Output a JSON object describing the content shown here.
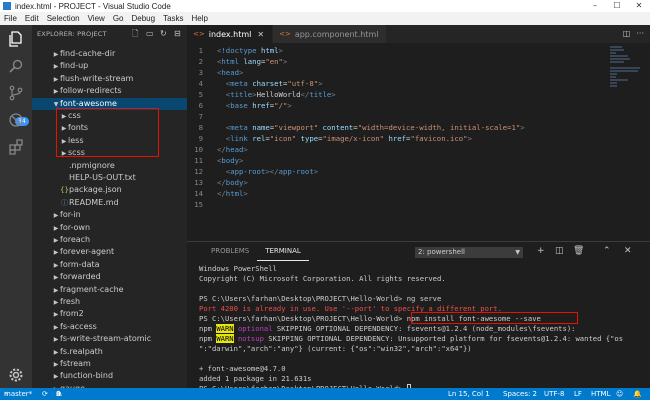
{
  "window": {
    "title": "index.html - PROJECT - Visual Studio Code",
    "controls": [
      "–",
      "☐",
      "✕"
    ]
  },
  "menu": [
    "File",
    "Edit",
    "Selection",
    "View",
    "Go",
    "Debug",
    "Tasks",
    "Help"
  ],
  "activity": {
    "scm_badge": "34"
  },
  "sidebar": {
    "header": "EXPLORER: PROJECT",
    "rows": [
      {
        "label": "find-cache-dir",
        "type": "folder"
      },
      {
        "label": "find-up",
        "type": "folder"
      },
      {
        "label": "flush-write-stream",
        "type": "folder"
      },
      {
        "label": "follow-redirects",
        "type": "folder"
      },
      {
        "label": "font-awesome",
        "type": "folder-open",
        "selected": true
      },
      {
        "label": "css",
        "type": "folder",
        "nested": true
      },
      {
        "label": "fonts",
        "type": "folder",
        "nested": true
      },
      {
        "label": "less",
        "type": "folder",
        "nested": true
      },
      {
        "label": "scss",
        "type": "folder",
        "nested": true
      },
      {
        "label": ".npmignore",
        "type": "file",
        "nested": true
      },
      {
        "label": "HELP-US-OUT.txt",
        "type": "file",
        "nested": true
      },
      {
        "label": "package.json",
        "type": "json",
        "nested": true
      },
      {
        "label": "README.md",
        "type": "md",
        "nested": true
      },
      {
        "label": "for-in",
        "type": "folder"
      },
      {
        "label": "for-own",
        "type": "folder"
      },
      {
        "label": "foreach",
        "type": "folder"
      },
      {
        "label": "forever-agent",
        "type": "folder"
      },
      {
        "label": "form-data",
        "type": "folder"
      },
      {
        "label": "forwarded",
        "type": "folder"
      },
      {
        "label": "fragment-cache",
        "type": "folder"
      },
      {
        "label": "fresh",
        "type": "folder"
      },
      {
        "label": "from2",
        "type": "folder"
      },
      {
        "label": "fs-access",
        "type": "folder"
      },
      {
        "label": "fs-write-stream-atomic",
        "type": "folder"
      },
      {
        "label": "fs.realpath",
        "type": "folder"
      },
      {
        "label": "fstream",
        "type": "folder"
      },
      {
        "label": "function-bind",
        "type": "folder"
      },
      {
        "label": "gauge",
        "type": "folder"
      }
    ]
  },
  "tabs": [
    {
      "label": "index.html",
      "active": true
    },
    {
      "label": "app.component.html",
      "active": false
    }
  ],
  "editor": {
    "lines": [
      "<!doctype html>",
      "<html lang=\"en\">",
      "<head>",
      "  <meta charset=\"utf-8\">",
      "  <title>HelloWorld</title>",
      "  <base href=\"/\">",
      "",
      "  <meta name=\"viewport\" content=\"width=device-width, initial-scale=1\">",
      "  <link rel=\"icon\" type=\"image/x-icon\" href=\"favicon.ico\">",
      "</head>",
      "<body>",
      "  <app-root></app-root>",
      "</body>",
      "</html>"
    ]
  },
  "panel": {
    "tabs": [
      "PROBLEMS",
      "TERMINAL"
    ],
    "active_tab": "TERMINAL",
    "terminal_select": "2: powershell",
    "terminal": {
      "l1": "Windows PowerShell",
      "l2": "Copyright (C) Microsoft Corporation. All rights reserved.",
      "l3": "",
      "l4": "PS C:\\Users\\farhan\\Desktop\\PROJECT\\Hello-World> ng serve",
      "l5": "Port 4200 is already in use. Use '--port' to specify a different port.",
      "l6_prompt": "PS C:\\Users\\farhan\\Desktop\\PROJECT\\Hello-World> ",
      "l6_cmd": "npm install font-awesome --save",
      "l7_npm": "npm ",
      "l7_warn": "WARN",
      "l7_opt": " optional",
      "l7_rest": " SKIPPING OPTIONAL DEPENDENCY: fsevents@1.2.4 (node_modules\\fsevents):",
      "l8_npm": "npm ",
      "l8_warn": "WARN",
      "l8_opt": " notsup",
      "l8_rest": " SKIPPING OPTIONAL DEPENDENCY: Unsupported platform for fsevents@1.2.4: wanted {\"os",
      "l9": "\":\"darwin\",\"arch\":\"any\"} (current: {\"os\":\"win32\",\"arch\":\"x64\"})",
      "l10": "",
      "l11": "+ font-awesome@4.7.0",
      "l12": "added 1 package in 21.631s",
      "l13": "PS C:\\Users\\farhan\\Desktop\\PROJECT\\Hello-World> "
    }
  },
  "status": {
    "branch": "master*",
    "sync": "⟳",
    "errors": "0",
    "warnings": "0",
    "position": "Ln 15, Col 1",
    "spaces": "Spaces: 2",
    "encoding": "UTF-8",
    "eol": "LF",
    "language": "HTML"
  },
  "colors": {
    "accent": "#007acc",
    "highlight_box": "#e51400",
    "selected_row": "#094771"
  }
}
